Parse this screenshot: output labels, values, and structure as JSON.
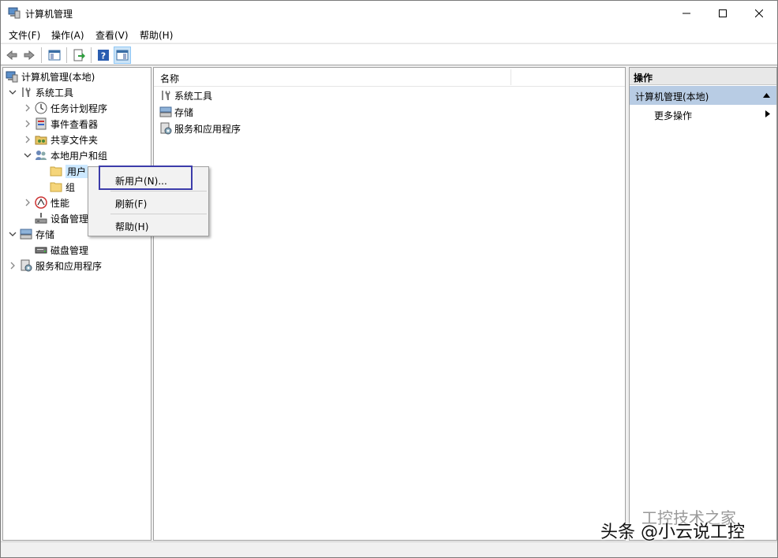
{
  "window": {
    "title": "计算机管理"
  },
  "menu": [
    "文件(F)",
    "操作(A)",
    "查看(V)",
    "帮助(H)"
  ],
  "tree": {
    "root": "计算机管理(本地)",
    "system_tools": "系统工具",
    "task_scheduler": "任务计划程序",
    "event_viewer": "事件查看器",
    "shared_folders": "共享文件夹",
    "local_users": "本地用户和组",
    "users": "用户",
    "groups": "组",
    "performance": "性能",
    "device_manager": "设备管理",
    "storage": "存储",
    "disk_management": "磁盘管理",
    "services_apps": "服务和应用程序"
  },
  "content": {
    "column_name": "名称",
    "items": [
      "系统工具",
      "存储",
      "服务和应用程序"
    ]
  },
  "actions": {
    "header": "操作",
    "section": "计算机管理(本地)",
    "more": "更多操作"
  },
  "context_menu": {
    "new_user": "新用户(N)...",
    "refresh": "刷新(F)",
    "help": "帮助(H)"
  },
  "watermark": {
    "main": "头条 @小云说工控",
    "faint": "工控技术之家"
  }
}
